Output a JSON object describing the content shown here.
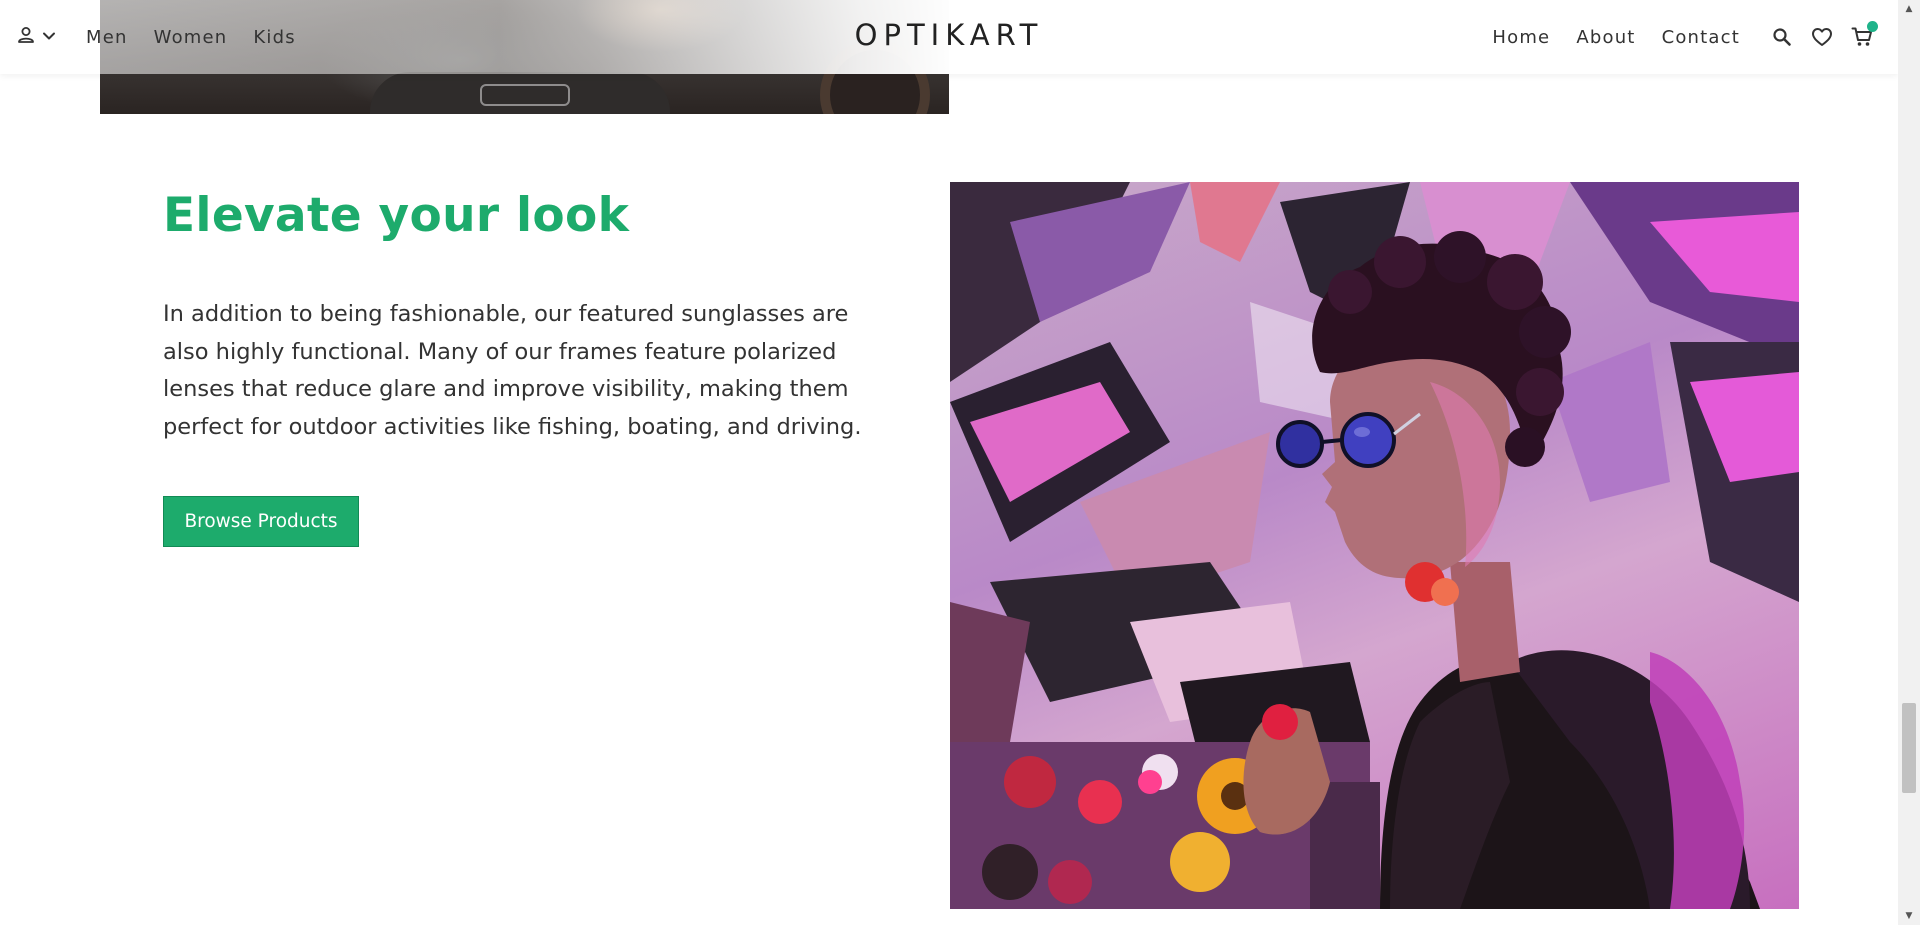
{
  "header": {
    "brand": "OPTIKART",
    "nav_left": [
      {
        "label": "Men"
      },
      {
        "label": "Women"
      },
      {
        "label": "Kids"
      }
    ],
    "nav_right": [
      {
        "label": "Home"
      },
      {
        "label": "About"
      },
      {
        "label": "Contact"
      }
    ],
    "icons": [
      "account-icon",
      "chevron-down-icon",
      "search-icon",
      "heart-icon",
      "cart-icon"
    ],
    "cart_badge_color": "#1fb38a"
  },
  "section": {
    "heading": "Elevate your look",
    "body": "In addition to being fashionable, our featured sunglasses are also highly functional. Many of our frames feature polarized lenses that reduce glare and improve visibility, making them perfect for outdoor activities like fishing, boating, and driving.",
    "button_label": "Browse Products",
    "accent_color": "#1dab6c"
  },
  "scrollbar": {
    "position_fraction": 0.8
  }
}
